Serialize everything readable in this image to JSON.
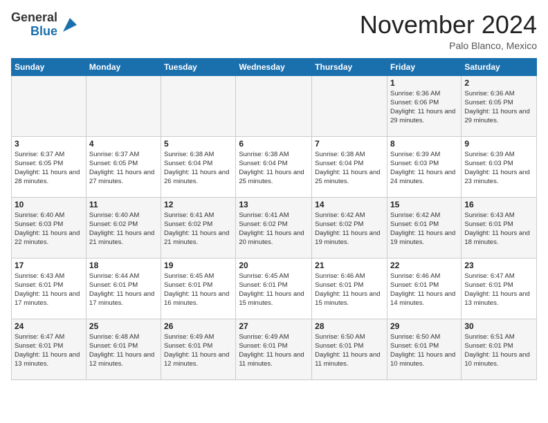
{
  "header": {
    "logo": {
      "general": "General",
      "blue": "Blue"
    },
    "title": "November 2024",
    "location": "Palo Blanco, Mexico"
  },
  "calendar": {
    "days_of_week": [
      "Sunday",
      "Monday",
      "Tuesday",
      "Wednesday",
      "Thursday",
      "Friday",
      "Saturday"
    ],
    "weeks": [
      [
        {
          "day": "",
          "info": ""
        },
        {
          "day": "",
          "info": ""
        },
        {
          "day": "",
          "info": ""
        },
        {
          "day": "",
          "info": ""
        },
        {
          "day": "",
          "info": ""
        },
        {
          "day": "1",
          "info": "Sunrise: 6:36 AM\nSunset: 6:06 PM\nDaylight: 11 hours and 29 minutes."
        },
        {
          "day": "2",
          "info": "Sunrise: 6:36 AM\nSunset: 6:05 PM\nDaylight: 11 hours and 29 minutes."
        }
      ],
      [
        {
          "day": "3",
          "info": "Sunrise: 6:37 AM\nSunset: 6:05 PM\nDaylight: 11 hours and 28 minutes."
        },
        {
          "day": "4",
          "info": "Sunrise: 6:37 AM\nSunset: 6:05 PM\nDaylight: 11 hours and 27 minutes."
        },
        {
          "day": "5",
          "info": "Sunrise: 6:38 AM\nSunset: 6:04 PM\nDaylight: 11 hours and 26 minutes."
        },
        {
          "day": "6",
          "info": "Sunrise: 6:38 AM\nSunset: 6:04 PM\nDaylight: 11 hours and 25 minutes."
        },
        {
          "day": "7",
          "info": "Sunrise: 6:38 AM\nSunset: 6:04 PM\nDaylight: 11 hours and 25 minutes."
        },
        {
          "day": "8",
          "info": "Sunrise: 6:39 AM\nSunset: 6:03 PM\nDaylight: 11 hours and 24 minutes."
        },
        {
          "day": "9",
          "info": "Sunrise: 6:39 AM\nSunset: 6:03 PM\nDaylight: 11 hours and 23 minutes."
        }
      ],
      [
        {
          "day": "10",
          "info": "Sunrise: 6:40 AM\nSunset: 6:03 PM\nDaylight: 11 hours and 22 minutes."
        },
        {
          "day": "11",
          "info": "Sunrise: 6:40 AM\nSunset: 6:02 PM\nDaylight: 11 hours and 21 minutes."
        },
        {
          "day": "12",
          "info": "Sunrise: 6:41 AM\nSunset: 6:02 PM\nDaylight: 11 hours and 21 minutes."
        },
        {
          "day": "13",
          "info": "Sunrise: 6:41 AM\nSunset: 6:02 PM\nDaylight: 11 hours and 20 minutes."
        },
        {
          "day": "14",
          "info": "Sunrise: 6:42 AM\nSunset: 6:02 PM\nDaylight: 11 hours and 19 minutes."
        },
        {
          "day": "15",
          "info": "Sunrise: 6:42 AM\nSunset: 6:01 PM\nDaylight: 11 hours and 19 minutes."
        },
        {
          "day": "16",
          "info": "Sunrise: 6:43 AM\nSunset: 6:01 PM\nDaylight: 11 hours and 18 minutes."
        }
      ],
      [
        {
          "day": "17",
          "info": "Sunrise: 6:43 AM\nSunset: 6:01 PM\nDaylight: 11 hours and 17 minutes."
        },
        {
          "day": "18",
          "info": "Sunrise: 6:44 AM\nSunset: 6:01 PM\nDaylight: 11 hours and 17 minutes."
        },
        {
          "day": "19",
          "info": "Sunrise: 6:45 AM\nSunset: 6:01 PM\nDaylight: 11 hours and 16 minutes."
        },
        {
          "day": "20",
          "info": "Sunrise: 6:45 AM\nSunset: 6:01 PM\nDaylight: 11 hours and 15 minutes."
        },
        {
          "day": "21",
          "info": "Sunrise: 6:46 AM\nSunset: 6:01 PM\nDaylight: 11 hours and 15 minutes."
        },
        {
          "day": "22",
          "info": "Sunrise: 6:46 AM\nSunset: 6:01 PM\nDaylight: 11 hours and 14 minutes."
        },
        {
          "day": "23",
          "info": "Sunrise: 6:47 AM\nSunset: 6:01 PM\nDaylight: 11 hours and 13 minutes."
        }
      ],
      [
        {
          "day": "24",
          "info": "Sunrise: 6:47 AM\nSunset: 6:01 PM\nDaylight: 11 hours and 13 minutes."
        },
        {
          "day": "25",
          "info": "Sunrise: 6:48 AM\nSunset: 6:01 PM\nDaylight: 11 hours and 12 minutes."
        },
        {
          "day": "26",
          "info": "Sunrise: 6:49 AM\nSunset: 6:01 PM\nDaylight: 11 hours and 12 minutes."
        },
        {
          "day": "27",
          "info": "Sunrise: 6:49 AM\nSunset: 6:01 PM\nDaylight: 11 hours and 11 minutes."
        },
        {
          "day": "28",
          "info": "Sunrise: 6:50 AM\nSunset: 6:01 PM\nDaylight: 11 hours and 11 minutes."
        },
        {
          "day": "29",
          "info": "Sunrise: 6:50 AM\nSunset: 6:01 PM\nDaylight: 11 hours and 10 minutes."
        },
        {
          "day": "30",
          "info": "Sunrise: 6:51 AM\nSunset: 6:01 PM\nDaylight: 11 hours and 10 minutes."
        }
      ]
    ]
  }
}
